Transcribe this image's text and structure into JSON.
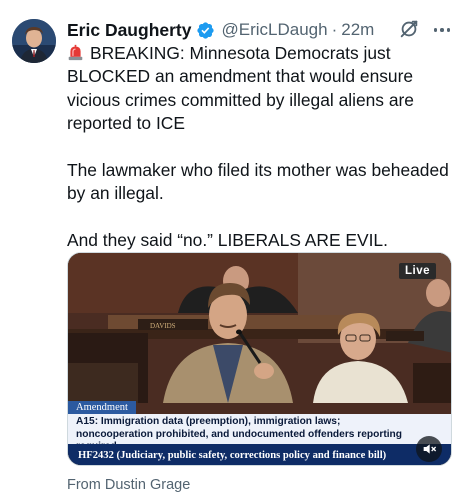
{
  "author": {
    "name": "Eric Daugherty",
    "handle": "@EricLDaugh",
    "separator": "·",
    "time": "22m"
  },
  "tweet": {
    "paragraph1": "BREAKING: Minnesota Democrats just BLOCKED an amendment that would ensure vicious crimes committed by illegal aliens are reported to ICE",
    "paragraph2": "The lawmaker who filed its mother was beheaded by an illegal.",
    "paragraph3": "And they said “no.” LIBERALS ARE EVIL."
  },
  "media": {
    "live_badge": "Live",
    "nameplate": "DAVIDS",
    "amendment_tag": "Amendment",
    "description_line1": "A15: Immigration data (preemption), immigration laws;",
    "description_line2": "noncooperation prohibited, and undocumented offenders reporting required",
    "bill_line": "HF2432 (Judiciary, public safety, corrections policy and finance bill)"
  },
  "footer": {
    "source": "From Dustin Grage"
  },
  "colors": {
    "text": "#0f1419",
    "secondary": "#536471",
    "verified": "#1d9bf0",
    "lower_third_blue": "#0e2c66"
  },
  "icons": {
    "verified": "verified-badge-icon",
    "grok": "grok-icon",
    "more": "more-icon",
    "siren": "siren-emoji-icon",
    "mute": "mute-icon"
  }
}
